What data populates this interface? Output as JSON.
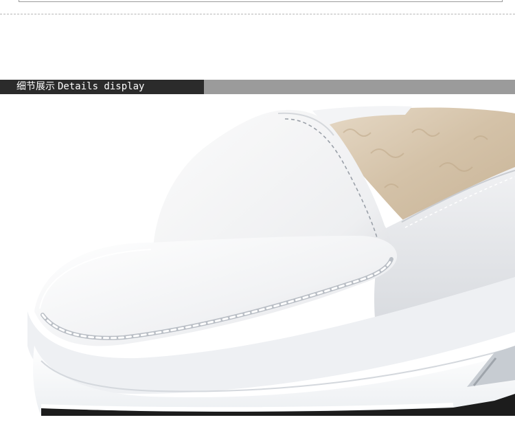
{
  "section": {
    "title_cn": "细节展示",
    "title_en": "Details display"
  },
  "photo": {
    "subject": "white-leather-loafer-fur-lined-closeup",
    "colors": {
      "leather": "#f4f4f4",
      "shadow": "#d9dbdf",
      "fur": "#d8c7b0",
      "sole": "#fbfbfb",
      "outsole": "#1c1c1c",
      "accent_bar_dark": "#2b2b2b",
      "accent_bar_gray": "#9b9b9b"
    }
  }
}
